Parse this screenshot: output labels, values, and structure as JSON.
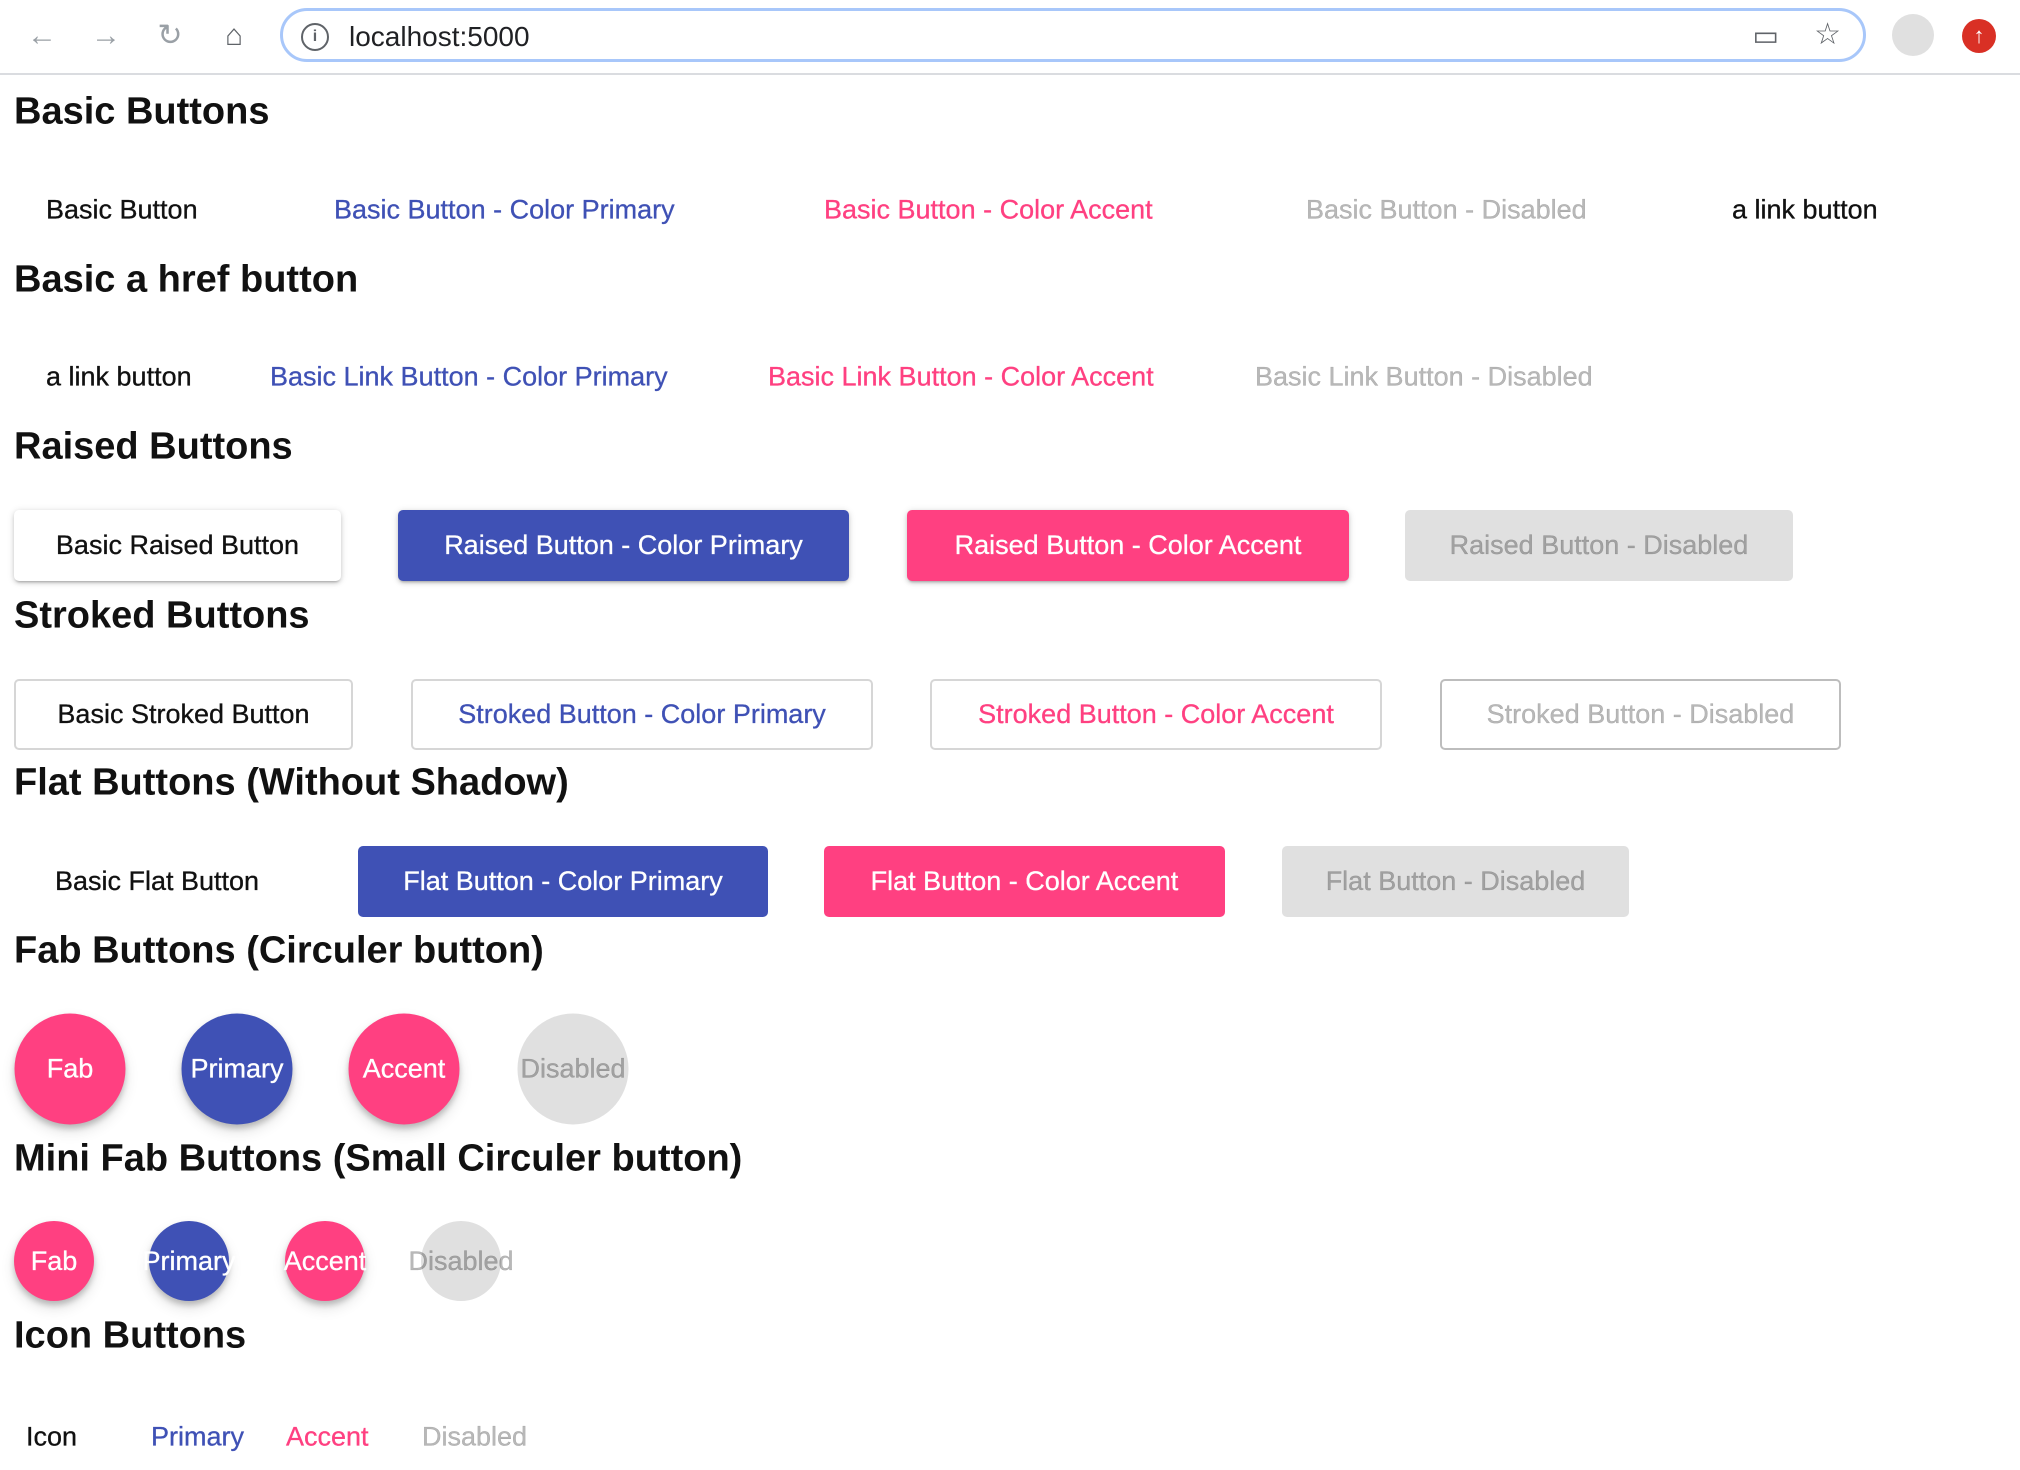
{
  "browser": {
    "url": "localhost:5000",
    "icons": [
      "back-icon",
      "forward-icon",
      "reload-icon",
      "home-icon",
      "info-icon",
      "cast-icon",
      "star-icon",
      "profile-icon",
      "update-icon"
    ]
  },
  "colors": {
    "primary": "#3f51b5",
    "accent": "#ff4081",
    "disabled_bg": "#e0e0e0"
  },
  "sections": {
    "basic": {
      "title": "Basic Buttons",
      "buttons": [
        "Basic Button",
        "Basic Button - Color Primary",
        "Basic Button - Color Accent",
        "Basic Button - Disabled",
        "a link button"
      ]
    },
    "href": {
      "title": "Basic a href button",
      "buttons": [
        "a link button",
        "Basic Link Button - Color Primary",
        "Basic Link Button - Color Accent",
        "Basic Link Button - Disabled"
      ]
    },
    "raised": {
      "title": "Raised Buttons",
      "buttons": [
        "Basic Raised Button",
        "Raised Button - Color Primary",
        "Raised Button - Color Accent",
        "Raised Button - Disabled"
      ]
    },
    "stroked": {
      "title": "Stroked Buttons",
      "buttons": [
        "Basic Stroked Button",
        "Stroked Button - Color Primary",
        "Stroked Button - Color Accent",
        "Stroked Button - Disabled"
      ]
    },
    "flat": {
      "title": "Flat Buttons (Without Shadow)",
      "buttons": [
        "Basic Flat Button",
        "Flat Button - Color Primary",
        "Flat Button - Color Accent",
        "Flat Button - Disabled"
      ]
    },
    "fab": {
      "title": "Fab Buttons (Circuler button)",
      "buttons": [
        "Fab",
        "Primary",
        "Accent",
        "Disabled"
      ]
    },
    "minifab": {
      "title": "Mini Fab Buttons (Small Circuler button)",
      "buttons": [
        "Fab",
        "Primary",
        "Accent",
        "Disabled"
      ]
    },
    "icon": {
      "title": "Icon Buttons",
      "buttons": [
        "Icon",
        "Primary",
        "Accent",
        "Disabled"
      ]
    }
  }
}
